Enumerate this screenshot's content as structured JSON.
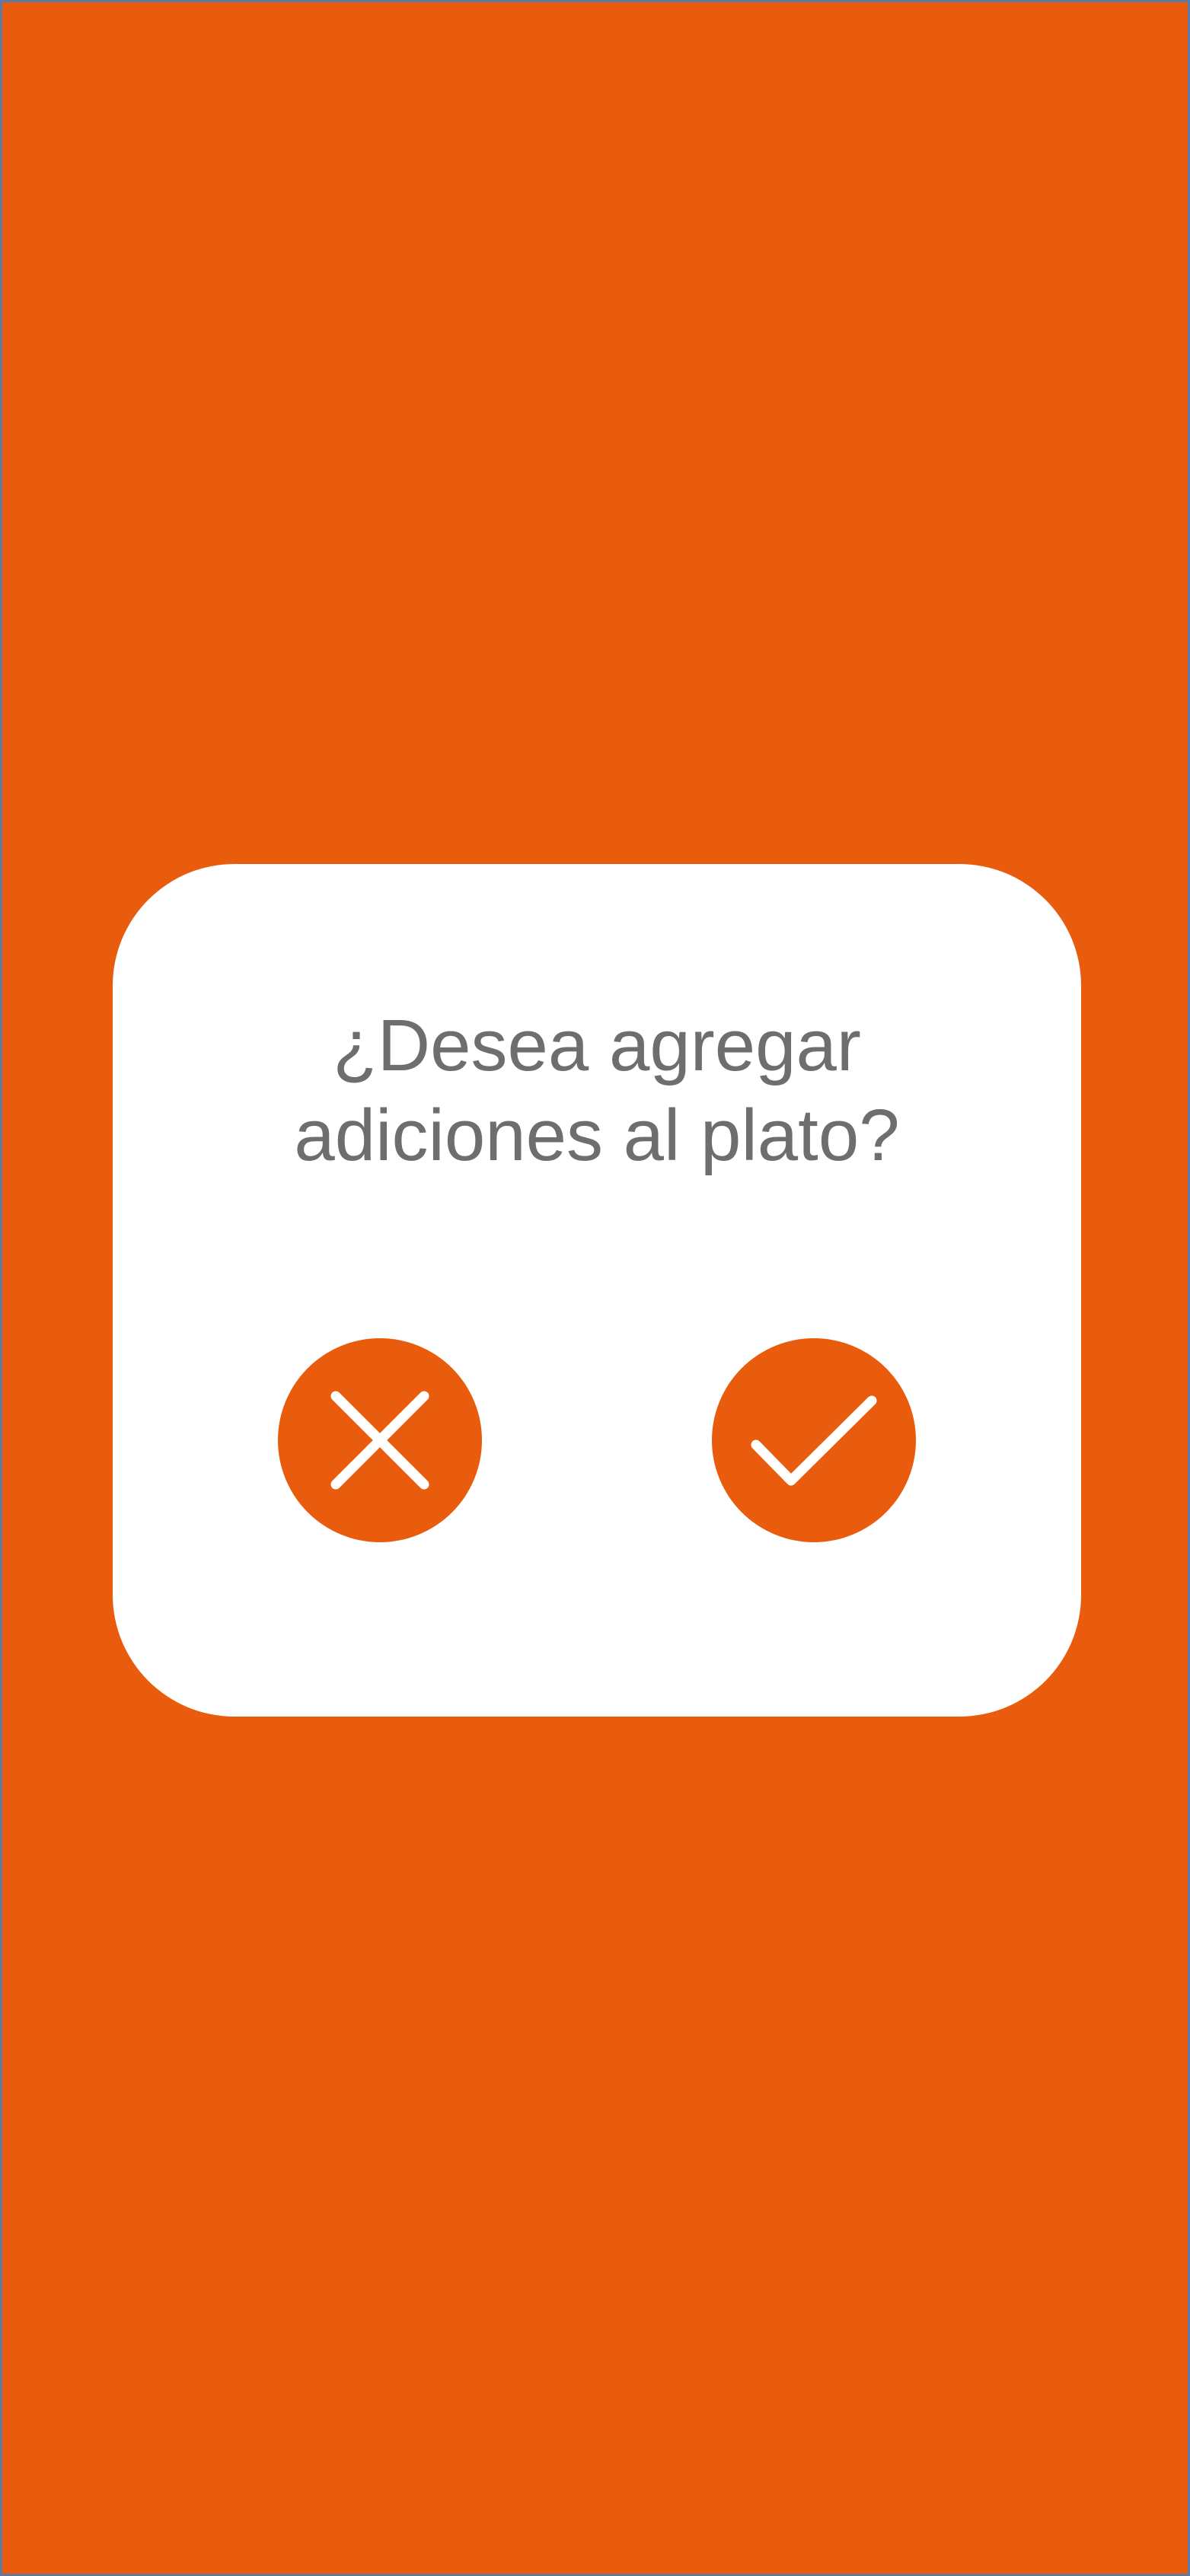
{
  "dialog": {
    "question_line_1": "¿Desea agregar",
    "question_line_2": "adiciones al plato?",
    "cancel_icon": "close-icon",
    "confirm_icon": "checkmark-icon"
  },
  "colors": {
    "accent": "#E95C0D",
    "surface": "#FFFFFF",
    "text": "#6E6E6E"
  }
}
